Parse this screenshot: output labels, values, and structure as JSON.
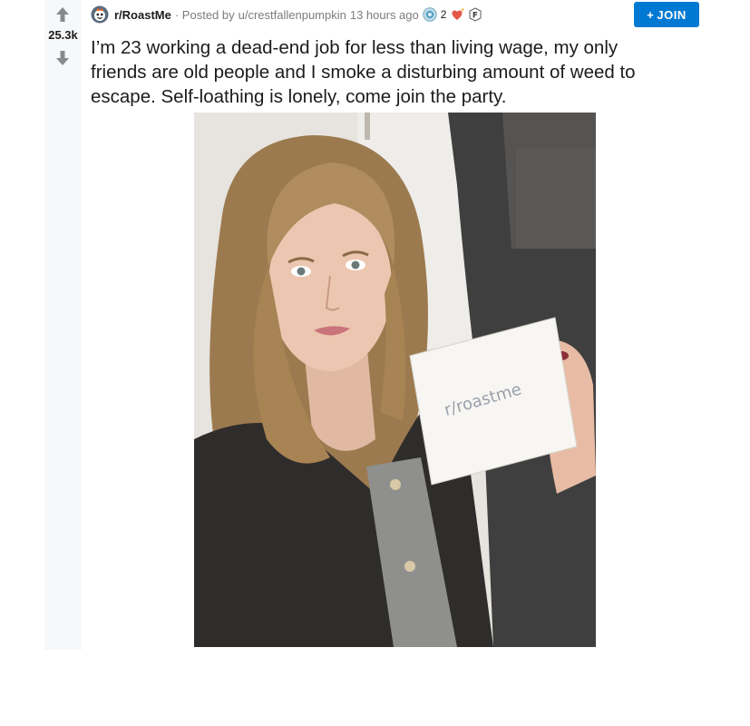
{
  "post": {
    "score": "25.3k",
    "subreddit": "r/RoastMe",
    "posted_by_prefix": "· Posted by",
    "author": "u/crestfallenpumpkin",
    "time_ago": "13 hours ago",
    "award_count": "2",
    "join_label": "JOIN",
    "join_plus": "+",
    "title": "I’m 23 working a dead-end job for less than living wage, my only friends are old people and I smoke a disturbing amount of weed to escape. Self-loathing is lonely, come join the party.",
    "image": {
      "sign_text": "r/roastme"
    }
  },
  "icons": {
    "upvote": "upvote-arrow-icon",
    "downvote": "downvote-arrow-icon",
    "subreddit": "roastme-subreddit-icon",
    "awards": [
      "silver-award-icon",
      "heart-award-icon",
      "f-award-icon"
    ]
  },
  "colors": {
    "join_button": "#0079d3",
    "vote_column": "#f7f8f9",
    "text_primary": "#1c1c1c",
    "text_muted": "#7c7c7c"
  }
}
